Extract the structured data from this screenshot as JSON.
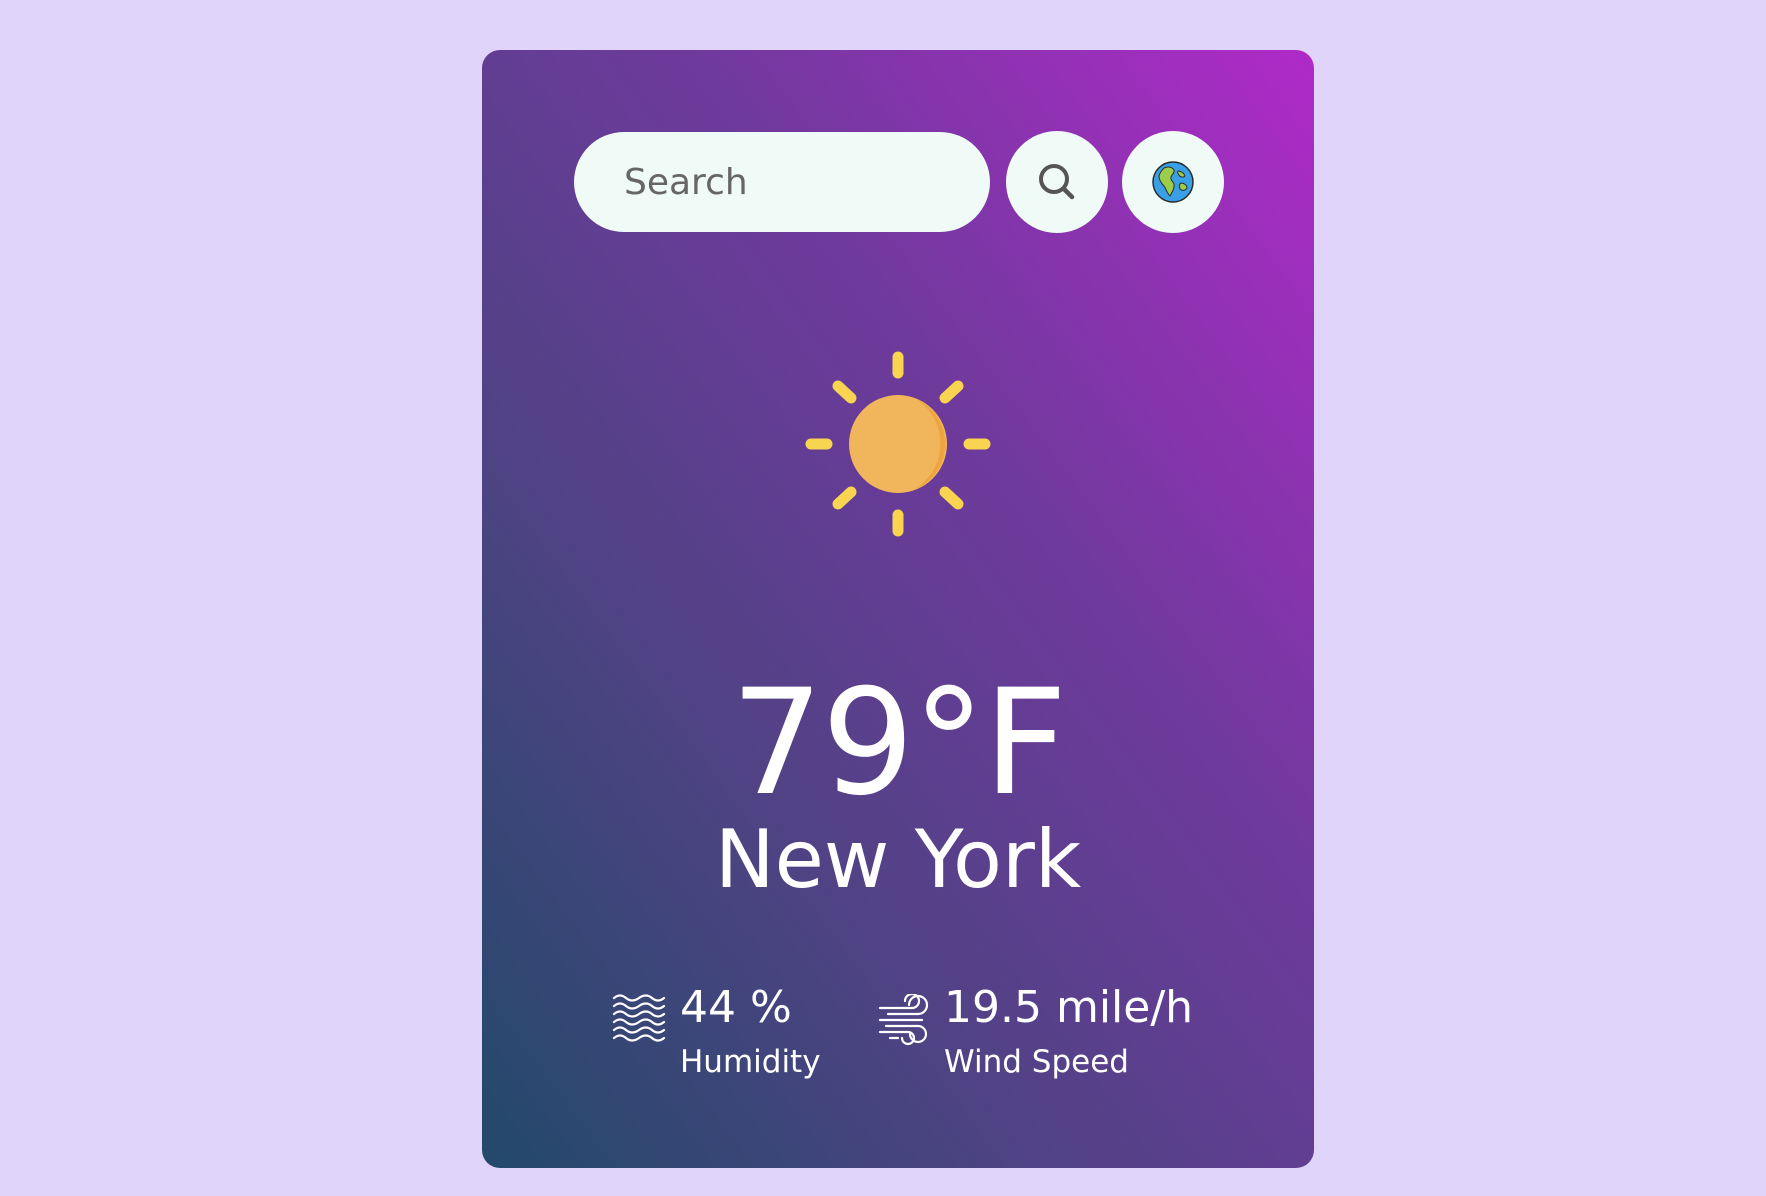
{
  "search": {
    "placeholder": "Search",
    "value": ""
  },
  "icons": {
    "search_button": "magnifier-icon",
    "location_button": "globe-icon",
    "weather": "sun-icon",
    "humidity": "waves-icon",
    "wind": "wind-icon"
  },
  "weather": {
    "temperature": "79°F",
    "city": "New York"
  },
  "details": {
    "humidity": {
      "value": "44 %",
      "label": "Humidity"
    },
    "wind": {
      "value": "19.5 mile/h",
      "label": "Wind Speed"
    }
  },
  "colors": {
    "page_background": "#e0d4fb",
    "card_gradient_start": "#22496a",
    "card_gradient_end": "#b02ac9",
    "button_background": "#f0fbf8",
    "sun_core": "#f1b65c",
    "sun_rays": "#f8d451"
  }
}
